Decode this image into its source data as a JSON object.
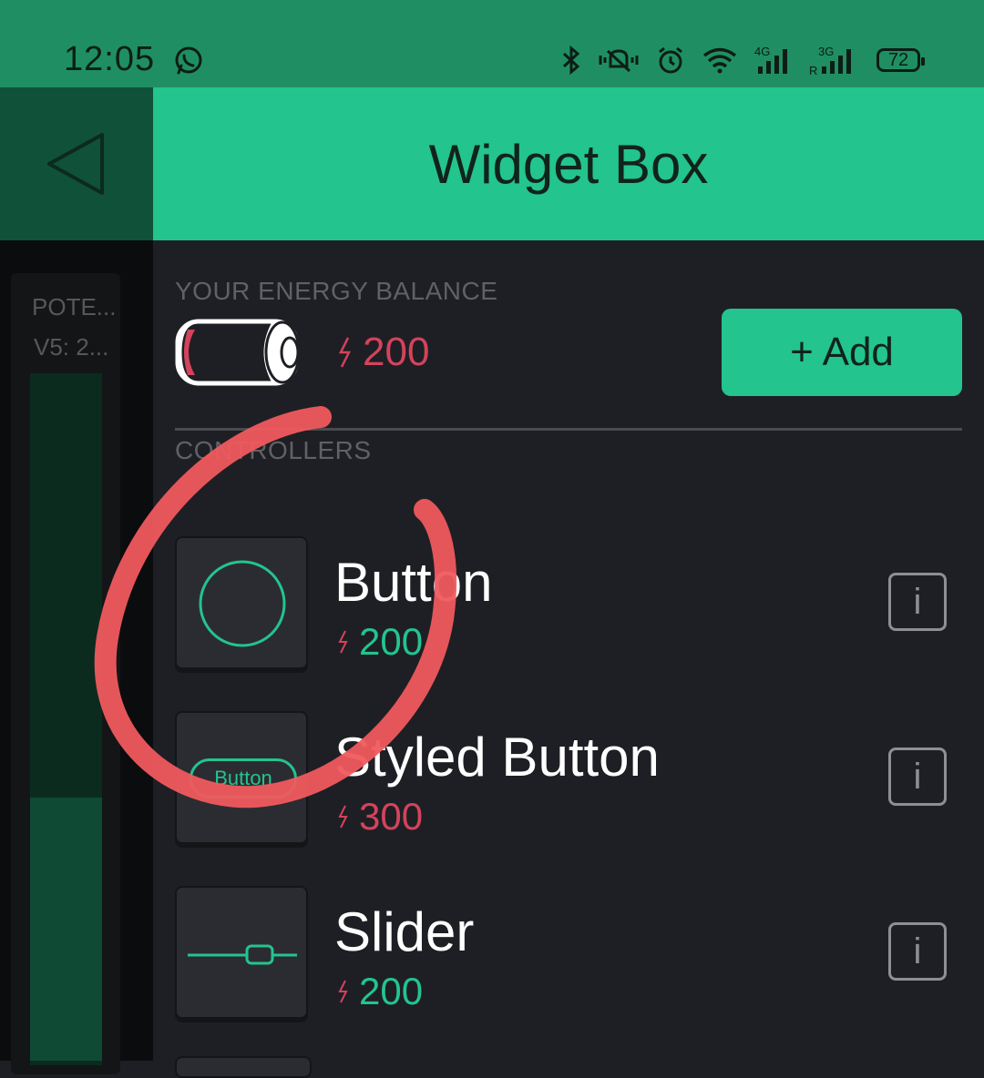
{
  "status_bar": {
    "time": "12:05",
    "battery": "72",
    "network_4g": "4G",
    "network_3g": "3G",
    "roaming": "R",
    "icons": [
      "whatsapp-icon",
      "bluetooth-icon",
      "mute-icon",
      "alarm-icon",
      "wifi-icon",
      "signal-4g-icon",
      "signal-3g-icon",
      "battery-icon"
    ]
  },
  "project_preview": {
    "widget_title": "POTE...",
    "widget_value": "V5: 2...",
    "level_fraction": 0.38
  },
  "header": {
    "title": "Widget Box",
    "back_icon": "back-arrow-icon"
  },
  "energy": {
    "label": "YOUR ENERGY BALANCE",
    "value": "200",
    "add_label": "+ Add"
  },
  "section": {
    "label": "CONTROLLERS"
  },
  "widgets": [
    {
      "name": "Button",
      "cost": "200",
      "affordable": true,
      "info_label": "i",
      "thumbnail": "round-button-icon"
    },
    {
      "name": "Styled Button",
      "cost": "300",
      "affordable": false,
      "info_label": "i",
      "thumbnail": "styled-button-icon",
      "thumb_text": "Button"
    },
    {
      "name": "Slider",
      "cost": "200",
      "affordable": true,
      "info_label": "i",
      "thumbnail": "slider-icon"
    }
  ],
  "colors": {
    "accent": "#23c48e",
    "status_bar": "#1f8f63",
    "background": "#1e1f24",
    "energy_low": "#d3435c",
    "annotation": "#f05a5e"
  }
}
